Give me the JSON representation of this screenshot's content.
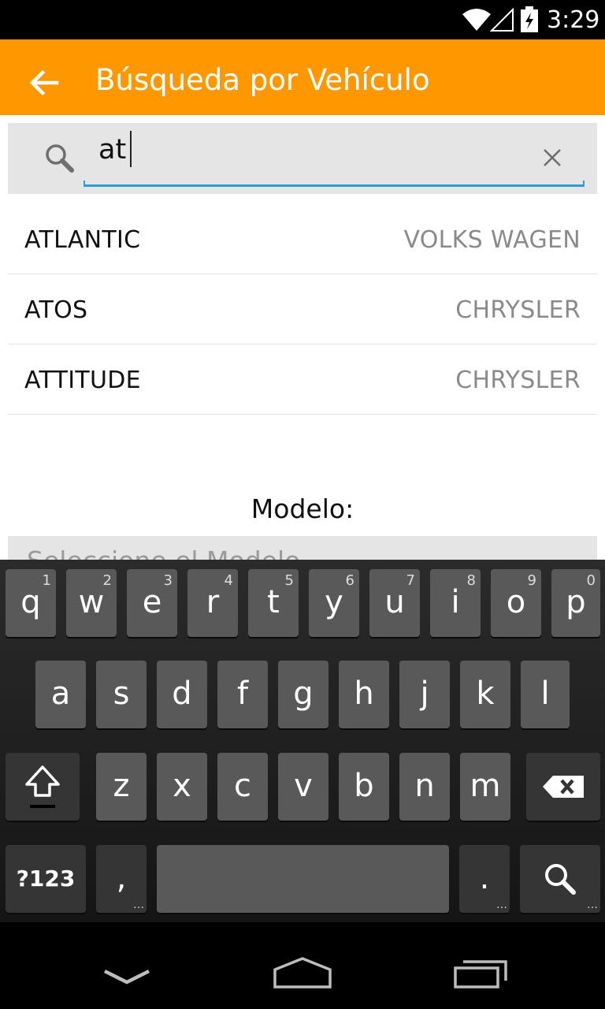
{
  "status_bar": {
    "time": "3:29",
    "icons": [
      "wifi-icon",
      "signal-icon",
      "battery-icon"
    ]
  },
  "action_bar": {
    "title": "Búsqueda por Vehículo",
    "back_icon": "arrow-left-icon"
  },
  "search": {
    "value": "at",
    "icons": [
      "search-icon",
      "close-icon"
    ],
    "accent": "#2a9fd6"
  },
  "results": [
    {
      "model": "ATLANTIC",
      "make": "VOLKS WAGEN"
    },
    {
      "model": "ATOS",
      "make": "CHRYSLER"
    },
    {
      "model": "ATTITUDE",
      "make": "CHRYSLER"
    }
  ],
  "modelo": {
    "label": "Modelo:",
    "placeholder": "Seleccione el Modelo"
  },
  "keyboard": {
    "row1": [
      {
        "key": "q",
        "hint": "1"
      },
      {
        "key": "w",
        "hint": "2"
      },
      {
        "key": "e",
        "hint": "3"
      },
      {
        "key": "r",
        "hint": "4"
      },
      {
        "key": "t",
        "hint": "5"
      },
      {
        "key": "y",
        "hint": "6"
      },
      {
        "key": "u",
        "hint": "7"
      },
      {
        "key": "i",
        "hint": "8"
      },
      {
        "key": "o",
        "hint": "9"
      },
      {
        "key": "p",
        "hint": "0"
      }
    ],
    "row2": [
      "a",
      "s",
      "d",
      "f",
      "g",
      "h",
      "j",
      "k",
      "l"
    ],
    "row3": [
      "z",
      "x",
      "c",
      "v",
      "b",
      "n",
      "m"
    ],
    "symbols_label": "?123",
    "comma": ",",
    "period": ".",
    "ellipsis": "…",
    "icons": [
      "shift-icon",
      "backspace-icon",
      "search-icon"
    ]
  },
  "nav_bar": {
    "icons": [
      "back-chevron-icon",
      "home-icon",
      "recents-icon"
    ]
  },
  "colors": {
    "primary": "#ff9800",
    "background": "#ffffff",
    "field": "#e5e5e5"
  }
}
